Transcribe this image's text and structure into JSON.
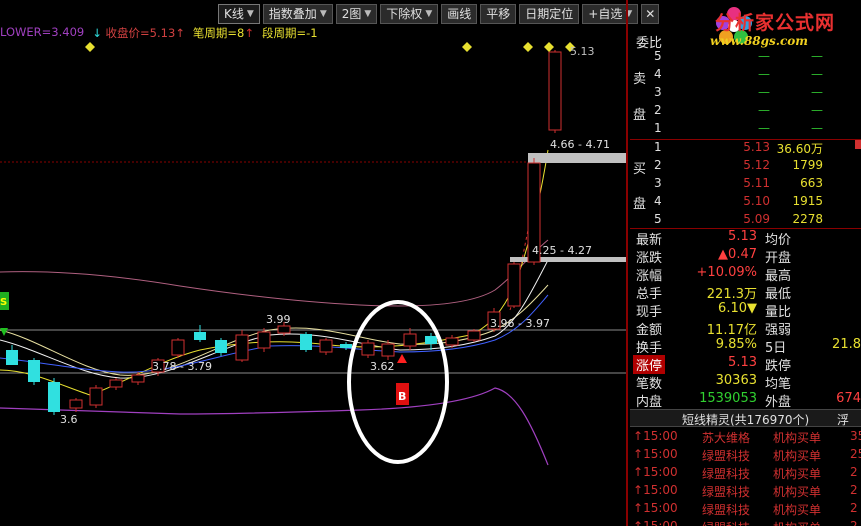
{
  "toolbar": {
    "items": [
      {
        "label": "K线",
        "dropdown": true
      },
      {
        "label": "指数叠加",
        "dropdown": true
      },
      {
        "label": "2图",
        "dropdown": true
      },
      {
        "label": "下除权",
        "dropdown": true
      },
      {
        "label": "画线",
        "dropdown": false
      },
      {
        "label": "平移",
        "dropdown": false
      },
      {
        "label": "日期定位",
        "dropdown": false
      },
      {
        "label": "+自选",
        "dropdown": true
      }
    ],
    "close_label": "✕"
  },
  "indicator": {
    "lower": "LOWER=3.409",
    "close": "收盘价=5.13",
    "pen": "笔周期=8",
    "segment": "段周期=-1"
  },
  "chart_labels": {
    "top_price": "5.13",
    "zone_high": "4.66 - 4.71",
    "zone_mid": "4.25 - 4.27",
    "zone_low": "3.96 - 3.97",
    "zone_left": "3.78 - 3.79",
    "peak_left": "3.99",
    "low_mid": "3.62",
    "low_left": "3.6",
    "buy_signal": "B",
    "s_marker": "S"
  },
  "logo": {
    "title": "分析家公式网",
    "url": "www.88gs.com"
  },
  "orderbook": {
    "header": "委比",
    "sell_label_top": "卖",
    "sell_label_bottom": "盘",
    "buy_label_top": "买",
    "buy_label_bottom": "盘",
    "sell": [
      {
        "level": "5",
        "price": "—",
        "vol": "—"
      },
      {
        "level": "4",
        "price": "—",
        "vol": "—"
      },
      {
        "level": "3",
        "price": "—",
        "vol": "—"
      },
      {
        "level": "2",
        "price": "—",
        "vol": "—"
      },
      {
        "level": "1",
        "price": "—",
        "vol": "—"
      }
    ],
    "buy": [
      {
        "level": "1",
        "price": "5.13",
        "vol": "36.60万"
      },
      {
        "level": "2",
        "price": "5.12",
        "vol": "1799"
      },
      {
        "level": "3",
        "price": "5.11",
        "vol": "663"
      },
      {
        "level": "4",
        "price": "5.10",
        "vol": "1915"
      },
      {
        "level": "5",
        "price": "5.09",
        "vol": "2278"
      }
    ]
  },
  "quote": [
    {
      "l1": "最新",
      "v1": "5.13",
      "c1": "red",
      "l2": "均价",
      "v2": ""
    },
    {
      "l1": "涨跌",
      "v1": "▲0.47",
      "c1": "red",
      "l2": "开盘",
      "v2": ""
    },
    {
      "l1": "涨幅",
      "v1": "+10.09%",
      "c1": "red",
      "l2": "最高",
      "v2": ""
    },
    {
      "l1": "总手",
      "v1": "221.3万",
      "c1": "yellow",
      "l2": "最低",
      "v2": ""
    },
    {
      "l1": "现手",
      "v1": "6.10▼",
      "c1": "yellow",
      "l2": "量比",
      "v2": ""
    },
    {
      "l1": "金额",
      "v1": "11.17亿",
      "c1": "yellow",
      "l2": "强弱",
      "v2": ""
    },
    {
      "l1": "换手",
      "v1": "9.85%",
      "c1": "yellow",
      "l2": "5日",
      "v2": "21.8"
    },
    {
      "l1": "涨停",
      "v1": "5.13",
      "c1": "red",
      "l2": "跌停",
      "v2": "",
      "hl": true
    },
    {
      "l1": "笔数",
      "v1": "30363",
      "c1": "yellow",
      "l2": "均笔",
      "v2": ""
    },
    {
      "l1": "内盘",
      "v1": "1539053",
      "c1": "green",
      "l2": "外盘",
      "v2": "674"
    }
  ],
  "sprite": {
    "title": "短线精灵(共176970个)",
    "float_label": "浮",
    "rows": [
      {
        "time": "15:00",
        "name": "苏大维格",
        "type": "机构买单",
        "num": "35"
      },
      {
        "time": "15:00",
        "name": "绿盟科技",
        "type": "机构买单",
        "num": "25"
      },
      {
        "time": "15:00",
        "name": "绿盟科技",
        "type": "机构买单",
        "num": "2"
      },
      {
        "time": "15:00",
        "name": "绿盟科技",
        "type": "机构买单",
        "num": "2"
      },
      {
        "time": "15:00",
        "name": "绿盟科技",
        "type": "机构买单",
        "num": "2"
      },
      {
        "time": "15:00",
        "name": "绿盟科技",
        "type": "机构买单",
        "num": "2"
      }
    ]
  },
  "colors": {
    "up": "#d03030",
    "down": "#30e0e0",
    "accent": "#e8e030",
    "background": "#000000"
  }
}
